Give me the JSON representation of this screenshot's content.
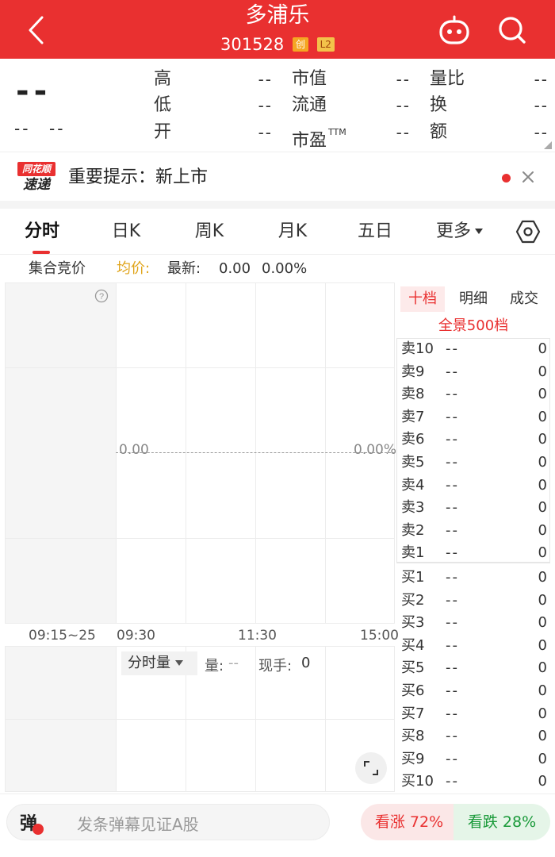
{
  "header": {
    "title": "多浦乐",
    "code": "301528",
    "badge_chuang": "创",
    "badge_l2": "L2"
  },
  "quote": {
    "price": "--",
    "change": "--",
    "change_pct": "--",
    "fields": [
      {
        "label": "高",
        "value": "--"
      },
      {
        "label": "低",
        "value": "--"
      },
      {
        "label": "开",
        "value": "--"
      },
      {
        "label": "市值",
        "value": "--"
      },
      {
        "label": "流通",
        "value": "--"
      },
      {
        "label": "市盈",
        "sup": "TTM",
        "value": "--"
      },
      {
        "label": "量比",
        "value": "--"
      },
      {
        "label": "换",
        "value": "--"
      },
      {
        "label": "额",
        "value": "--"
      }
    ]
  },
  "notice": {
    "logo_top": "同花顺",
    "logo_bottom": "速递",
    "text": "重要提示：新上市"
  },
  "tabs": [
    "分时",
    "日K",
    "周K",
    "月K",
    "五日",
    "更多"
  ],
  "status": {
    "auction": "集合竞价",
    "avg_label": "均价:",
    "latest_label": "最新:",
    "latest_value": "0.00",
    "latest_pct": "0.00%"
  },
  "chart": {
    "price_label": "0.00",
    "pct_label": "0.00%",
    "times": [
      "09:15~25",
      "09:30",
      "11:30",
      "15:00"
    ],
    "volume_dropdown": "分时量",
    "volume_label": "量:",
    "volume_value": "--",
    "hand_label": "现手:",
    "hand_value": "0"
  },
  "orderbook": {
    "tabs": [
      "十档",
      "明细",
      "成交"
    ],
    "panorama": "全景500档",
    "sell": [
      {
        "name": "卖10",
        "price": "--",
        "vol": "0"
      },
      {
        "name": "卖9",
        "price": "--",
        "vol": "0"
      },
      {
        "name": "卖8",
        "price": "--",
        "vol": "0"
      },
      {
        "name": "卖7",
        "price": "--",
        "vol": "0"
      },
      {
        "name": "卖6",
        "price": "--",
        "vol": "0"
      },
      {
        "name": "卖5",
        "price": "--",
        "vol": "0"
      },
      {
        "name": "卖4",
        "price": "--",
        "vol": "0"
      },
      {
        "name": "卖3",
        "price": "--",
        "vol": "0"
      },
      {
        "name": "卖2",
        "price": "--",
        "vol": "0"
      },
      {
        "name": "卖1",
        "price": "--",
        "vol": "0"
      }
    ],
    "buy": [
      {
        "name": "买1",
        "price": "--",
        "vol": "0"
      },
      {
        "name": "买2",
        "price": "--",
        "vol": "0"
      },
      {
        "name": "买3",
        "price": "--",
        "vol": "0"
      },
      {
        "name": "买4",
        "price": "--",
        "vol": "0"
      },
      {
        "name": "买5",
        "price": "--",
        "vol": "0"
      },
      {
        "name": "买6",
        "price": "--",
        "vol": "0"
      },
      {
        "name": "买7",
        "price": "--",
        "vol": "0"
      },
      {
        "name": "买8",
        "price": "--",
        "vol": "0"
      },
      {
        "name": "买9",
        "price": "--",
        "vol": "0"
      },
      {
        "name": "买10",
        "price": "--",
        "vol": "0"
      }
    ]
  },
  "bottom": {
    "danmu_icon": "弹",
    "danmu_placeholder": "发条弹幕见证A股",
    "bull": "看涨 72%",
    "bear": "看跌 28%"
  },
  "colors": {
    "brand": "#e93030",
    "avg_line": "#e0a41a",
    "bull_text": "#e93030",
    "bear_text": "#1a9a3a"
  }
}
